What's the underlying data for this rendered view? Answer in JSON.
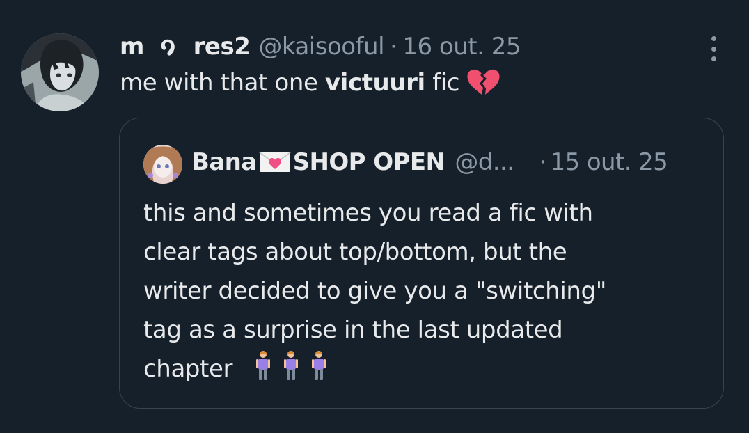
{
  "tweet": {
    "display_name_pre": "m",
    "display_name_post": "res2",
    "handle": "@kaisooful",
    "separator": "·",
    "date": "16 out. 25",
    "text_pre": "me with that one ",
    "text_bold": "victuuri",
    "text_post": " fic",
    "text_emoji": "broken-heart",
    "name_icon": "ear-icon",
    "more_icon": "more-vertical-icon"
  },
  "quote": {
    "display_name_pre": "Bana",
    "display_name_post": "SHOP OPEN",
    "name_emoji": "love-letter",
    "handle": "@d...",
    "separator": "·",
    "date": "15 out. 25",
    "lines": [
      "this and sometimes you read a fic with",
      "clear tags about top/bottom, but the",
      "writer decided to give you a \"switching\"",
      "tag as a surprise in the last updated",
      "chapter"
    ],
    "trailing_emoji": "person-standing",
    "trailing_emoji_count": 3
  },
  "colors": {
    "background": "#15202b",
    "text": "#e7e9ea",
    "muted": "#8b98a5",
    "border": "#38444d",
    "heart": "#f0506e",
    "envelope_heart": "#f24e86",
    "person": "#9a7fe8"
  }
}
